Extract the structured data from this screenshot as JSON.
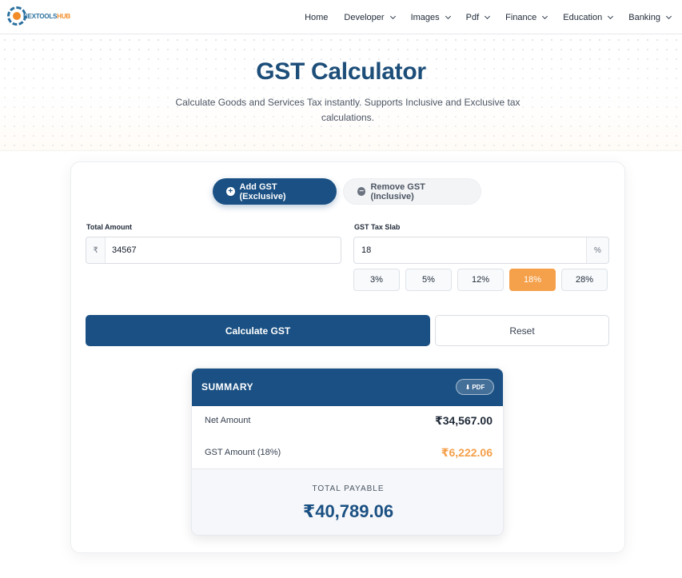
{
  "navbar": {
    "logo_text_prefix": "NEXTOOLS",
    "logo_text_suffix": "HUB",
    "items": [
      {
        "label": "Home",
        "has_dropdown": false
      },
      {
        "label": "Developer",
        "has_dropdown": true
      },
      {
        "label": "Images",
        "has_dropdown": true
      },
      {
        "label": "Pdf",
        "has_dropdown": true
      },
      {
        "label": "Finance",
        "has_dropdown": true
      },
      {
        "label": "Education",
        "has_dropdown": true
      },
      {
        "label": "Banking",
        "has_dropdown": true
      }
    ]
  },
  "hero": {
    "title": "GST Calculator",
    "subtitle": "Calculate Goods and Services Tax instantly. Supports Inclusive and Exclusive tax calculations."
  },
  "mode_toggle": {
    "add_label": "Add GST (Exclusive)",
    "remove_label": "Remove GST (Inclusive)",
    "selected": "add"
  },
  "form": {
    "amount_label": "Total Amount",
    "amount_prefix": "₹",
    "amount_value": "34567",
    "rate_label": "GST Tax Slab",
    "rate_value": "18",
    "rate_suffix": "%",
    "slabs": [
      "3%",
      "5%",
      "12%",
      "18%",
      "28%"
    ],
    "selected_slab": "18%",
    "calculate_label": "Calculate GST",
    "reset_label": "Reset"
  },
  "summary": {
    "title": "SUMMARY",
    "pdf_label": "PDF",
    "net_label": "Net Amount",
    "net_value": "₹34,567.00",
    "gst_label": "GST Amount (18%)",
    "gst_value": "₹6,222.06",
    "total_label": "TOTAL PAYABLE",
    "total_value": "₹40,789.06"
  },
  "colors": {
    "primary": "#1a5083",
    "accent": "#f5a04a",
    "title": "#1d4e79"
  }
}
